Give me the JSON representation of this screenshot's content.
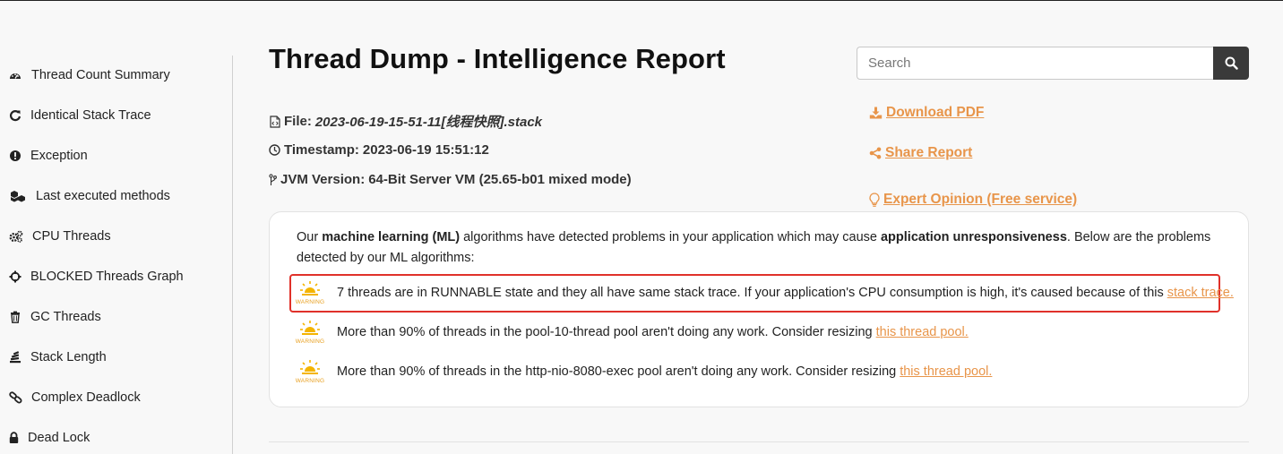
{
  "sidebar": {
    "items": [
      {
        "label": "Thread Count Summary",
        "icon": "dashboard-icon"
      },
      {
        "label": "Identical Stack Trace",
        "icon": "refresh-icon"
      },
      {
        "label": "Exception",
        "icon": "exclamation-circle-icon"
      },
      {
        "label": "Last executed methods",
        "icon": "cubes-icon"
      },
      {
        "label": "CPU Threads",
        "icon": "cogs-icon"
      },
      {
        "label": "BLOCKED Threads Graph",
        "icon": "crosshairs-icon"
      },
      {
        "label": "GC Threads",
        "icon": "trash-icon"
      },
      {
        "label": "Stack Length",
        "icon": "stack-icon"
      },
      {
        "label": "Complex Deadlock",
        "icon": "link-icon"
      },
      {
        "label": "Dead Lock",
        "icon": "lock-icon"
      }
    ]
  },
  "header": {
    "title": "Thread Dump - Intelligence Report",
    "search_placeholder": "Search"
  },
  "meta": {
    "file_label": "File:",
    "file_value": "2023-06-19-15-51-11[线程快照].stack",
    "timestamp_label": "Timestamp:",
    "timestamp_value": "2023-06-19 15:51:12",
    "jvm_label": "JVM Version:",
    "jvm_value": "64-Bit Server VM (25.65-b01 mixed mode)"
  },
  "actions": {
    "download": "Download PDF",
    "share": "Share Report",
    "expert": "Expert Opinion (Free service)"
  },
  "card": {
    "intro_1": "Our ",
    "intro_2": "machine learning (ML)",
    "intro_3": " algorithms have detected problems in your application which may cause ",
    "intro_4": "application unresponsiveness",
    "intro_5": ". Below are the problems detected by our ML algorithms:",
    "warning_badge": "WARNING",
    "warnings": [
      {
        "text": "7 threads are in RUNNABLE state and they all have same stack trace. If your application's CPU consumption is high, it's caused because of this",
        "link": "stack trace.",
        "highlighted": true
      },
      {
        "text": "More than 90% of threads in the pool-10-thread pool aren't doing any work. Consider resizing",
        "link": "this thread pool.",
        "highlighted": false
      },
      {
        "text": "More than 90% of threads in the http-nio-8080-exec pool aren't doing any work. Consider resizing",
        "link": "this thread pool.",
        "highlighted": false
      }
    ]
  },
  "colors": {
    "accent": "#e8954a",
    "highlight_border": "#e0312a",
    "search_button": "#3a3a3a",
    "warning_sun": "#f4b400"
  }
}
